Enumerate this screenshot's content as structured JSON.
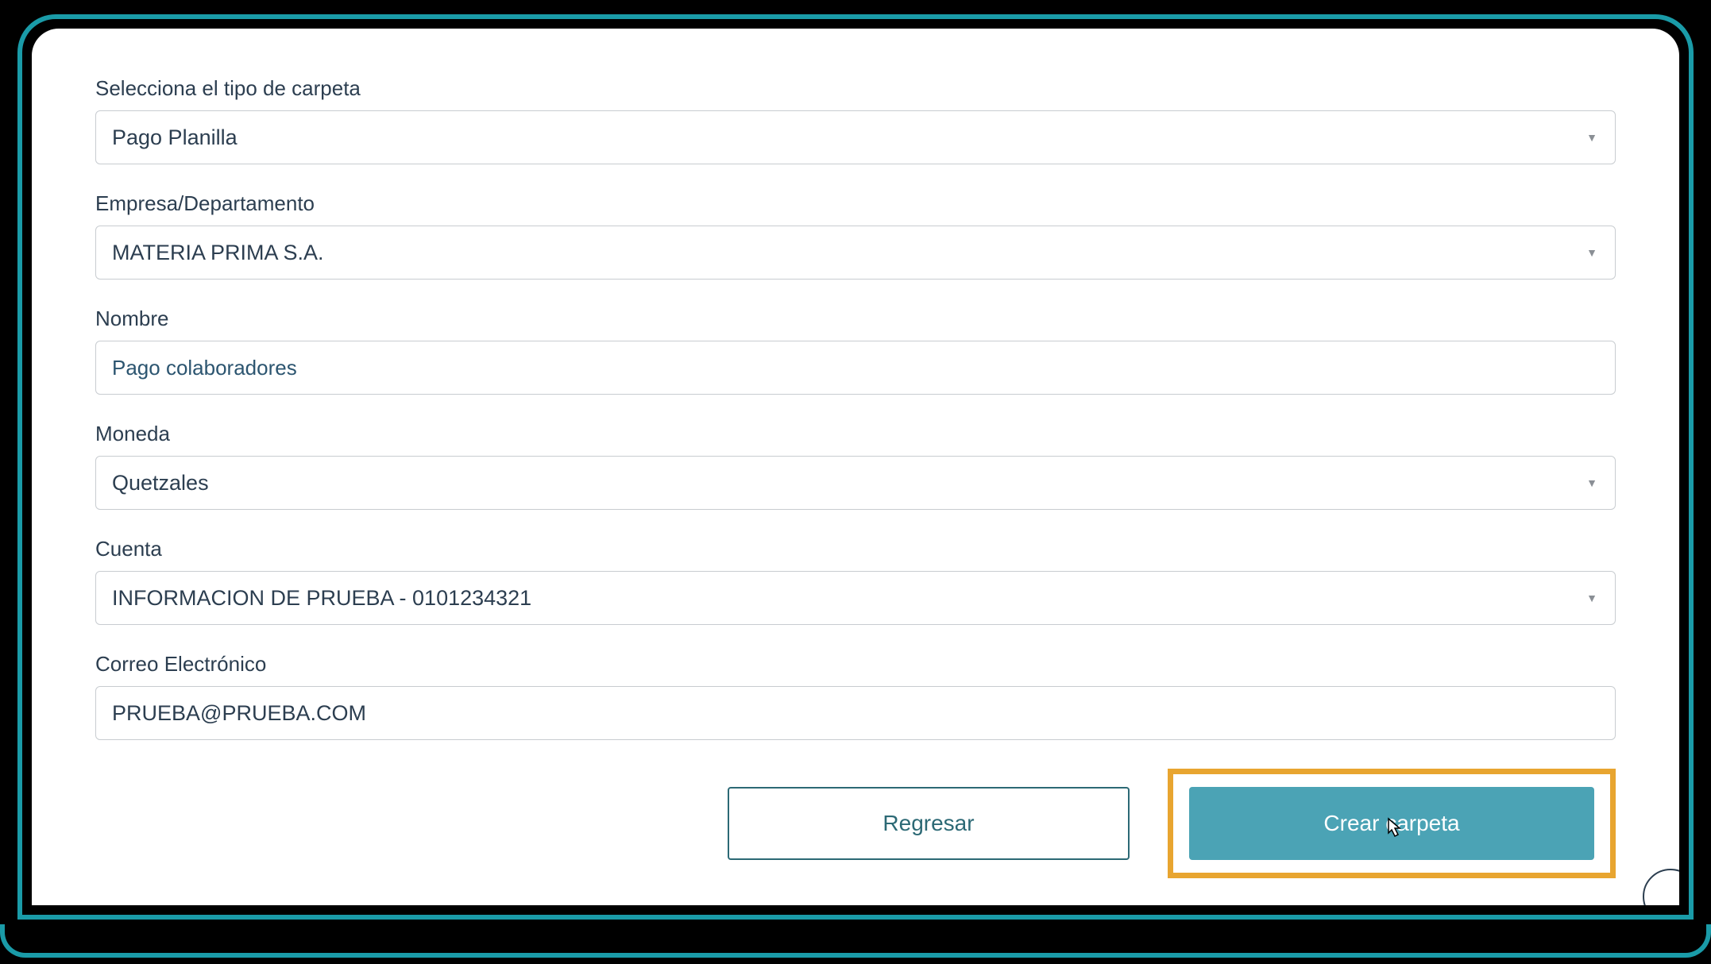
{
  "form": {
    "tipo_carpeta": {
      "label": "Selecciona el tipo de carpeta",
      "value": "Pago Planilla"
    },
    "empresa": {
      "label": "Empresa/Departamento",
      "value": "MATERIA PRIMA S.A."
    },
    "nombre": {
      "label": "Nombre",
      "value": "Pago colaboradores"
    },
    "moneda": {
      "label": "Moneda",
      "value": "Quetzales"
    },
    "cuenta": {
      "label": "Cuenta",
      "value": "INFORMACION DE PRUEBA - 0101234321"
    },
    "correo": {
      "label": "Correo Electrónico",
      "value": "PRUEBA@PRUEBA.COM"
    }
  },
  "buttons": {
    "back": "Regresar",
    "create": "Crear carpeta"
  }
}
